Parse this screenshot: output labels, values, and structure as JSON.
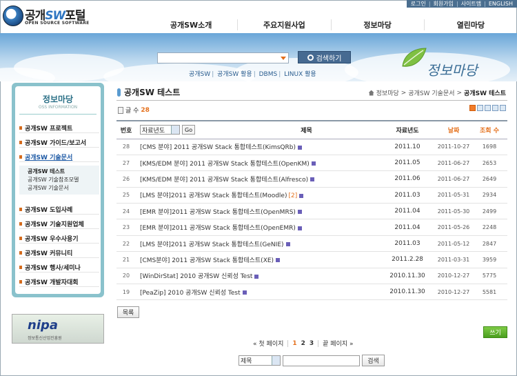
{
  "top_links": [
    "로그인",
    "회원가입",
    "사이트맵",
    "ENGLISH"
  ],
  "logo": {
    "kor_prefix": "공개",
    "kor_sw": "SW",
    "kor_suffix": "포털",
    "eng": "OPEN SOURCE SOFTWARE"
  },
  "gnb": [
    "공개SW소개",
    "주요지원사업",
    "정보마당",
    "열린마당"
  ],
  "search": {
    "button": "검색하기"
  },
  "quick_links": [
    "공개SW",
    "공개SW 활용",
    "DBMS",
    "LINUX 활용"
  ],
  "band_title": "정보마당",
  "lnb": {
    "title": "정보마당",
    "subtitle": "OSS INFORMATION",
    "items": [
      "공개SW 프로젝트",
      "공개SW 가이드/보고서",
      "공개SW 기술문서",
      "공개SW 도입사례",
      "공개SW 기술지원업체",
      "공개SW 우수사용기",
      "공개SW 커뮤니티",
      "공개SW 행사/세미나",
      "공개SW 개발자대회"
    ],
    "sub_items": [
      "공개SW 테스트",
      "공개SW 기술참조모델",
      "공개SW 기술문서"
    ]
  },
  "banner": {
    "name": "nipa",
    "sub": "정보통신산업진흥원"
  },
  "page_title": "공개SW 테스트",
  "breadcrumb": [
    "정보마당",
    "공개SW 기술문서",
    "공개SW 테스트"
  ],
  "count": {
    "label": "글 수",
    "value": "28"
  },
  "table": {
    "headers": {
      "num": "번호",
      "filter": "자료년도",
      "go": "Go",
      "title": "제목",
      "year": "자료년도",
      "date": "날짜",
      "views": "조회 수"
    },
    "rows": [
      {
        "num": "28",
        "title": "[CMS 분야] 2011 공개SW Stack 통합테스트(KimsQRb)",
        "comments": "",
        "year": "2011.10",
        "date": "2011-10-27",
        "views": "1698"
      },
      {
        "num": "27",
        "title": "[KMS/EDM 분야] 2011 공개SW Stack 통합테스트(OpenKM)",
        "comments": "",
        "year": "2011.05",
        "date": "2011-06-27",
        "views": "2653"
      },
      {
        "num": "26",
        "title": "[KMS/EDM 분야] 2011 공개SW Stack 통합테스트(Alfresco)",
        "comments": "",
        "year": "2011.06",
        "date": "2011-06-27",
        "views": "2649"
      },
      {
        "num": "25",
        "title": "[LMS 분야]2011 공개SW Stack 통합테스트(Moodle)",
        "comments": "[2]",
        "year": "2011.03",
        "date": "2011-05-31",
        "views": "2934"
      },
      {
        "num": "24",
        "title": "[EMR 분야]2011 공개SW Stack 통합테스트(OpenMRS)",
        "comments": "",
        "year": "2011.04",
        "date": "2011-05-30",
        "views": "2499"
      },
      {
        "num": "23",
        "title": "[EMR 분야]2011 공개SW Stack 통합테스트(OpenEMR)",
        "comments": "",
        "year": "2011.04",
        "date": "2011-05-26",
        "views": "2248"
      },
      {
        "num": "22",
        "title": "[LMS 분야]2011 공개SW Stack 통합테스트(GeNIE)",
        "comments": "",
        "year": "2011.03",
        "date": "2011-05-12",
        "views": "2847"
      },
      {
        "num": "21",
        "title": "[CMS분야] 2011 공개SW Stack 통합테스트(XE)",
        "comments": "",
        "year": "2011.2.28",
        "date": "2011-03-31",
        "views": "3959"
      },
      {
        "num": "20",
        "title": "[WinDirStat] 2010 공개SW 신뢰성 Test",
        "comments": "",
        "year": "2010.11.30",
        "date": "2010-12-27",
        "views": "5775"
      },
      {
        "num": "19",
        "title": "[PeaZip] 2010 공개SW 신뢰성 Test",
        "comments": "",
        "year": "2010.11.30",
        "date": "2010-12-27",
        "views": "5581"
      }
    ]
  },
  "buttons": {
    "list": "목록",
    "write": "쓰기",
    "search": "검색"
  },
  "paging": {
    "first": "첫 페이지",
    "pages": [
      "1",
      "2",
      "3"
    ],
    "last": "끝 페이지"
  },
  "bottom_search": {
    "field": "제목"
  },
  "colors": {
    "accent": "#e4701c",
    "nav_frame": "#8ac2cc",
    "write_button": "#5aa92b"
  }
}
